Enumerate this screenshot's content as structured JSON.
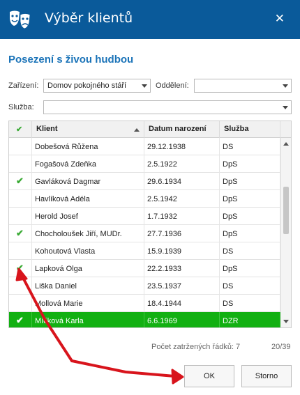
{
  "window": {
    "title": "Výběr klientů",
    "close_glyph": "✕",
    "icon": "theater-masks-icon"
  },
  "heading": "Posezení s živou hudbou",
  "filters": {
    "zarizeni_label": "Zařízení:",
    "zarizeni_value": "Domov pokojného stáří",
    "oddeleni_label": "Oddělení:",
    "oddeleni_value": "",
    "sluzba_label": "Služba:",
    "sluzba_value": ""
  },
  "grid": {
    "check_header_glyph": "✔",
    "columns": [
      "Klient",
      "Datum narození",
      "Služba"
    ],
    "rows": [
      {
        "checked": false,
        "client": "Dobešová Růžena",
        "birth": "29.12.1938",
        "service": "DS",
        "selected": false
      },
      {
        "checked": false,
        "client": "Fogašová Zdeňka",
        "birth": "2.5.1922",
        "service": "DpS",
        "selected": false
      },
      {
        "checked": true,
        "client": "Gavláková Dagmar",
        "birth": "29.6.1934",
        "service": "DpS",
        "selected": false
      },
      {
        "checked": false,
        "client": "Havlíková Adéla",
        "birth": "2.5.1942",
        "service": "DpS",
        "selected": false
      },
      {
        "checked": false,
        "client": "Herold Josef",
        "birth": "1.7.1932",
        "service": "DpS",
        "selected": false
      },
      {
        "checked": true,
        "client": "Chocholoušek Jiří, MUDr.",
        "birth": "27.7.1936",
        "service": "DpS",
        "selected": false
      },
      {
        "checked": false,
        "client": "Kohoutová Vlasta",
        "birth": "15.9.1939",
        "service": "DS",
        "selected": false
      },
      {
        "checked": true,
        "client": "Lapková Olga",
        "birth": "22.2.1933",
        "service": "DpS",
        "selected": false
      },
      {
        "checked": false,
        "client": "Liška Daniel",
        "birth": "23.5.1937",
        "service": "DS",
        "selected": false
      },
      {
        "checked": false,
        "client": "Mollová Marie",
        "birth": "18.4.1944",
        "service": "DS",
        "selected": false
      },
      {
        "checked": true,
        "client": "Míčková Karla",
        "birth": "6.6.1969",
        "service": "DZR",
        "selected": true
      }
    ]
  },
  "status": {
    "checked_rows_label": "Počet zatržených řádků: 7",
    "count": "20/39"
  },
  "buttons": {
    "ok": "OK",
    "cancel": "Storno"
  },
  "colors": {
    "titlebar": "#0a5a9a",
    "heading": "#1a73b8",
    "selection": "#12b012",
    "check": "#3aaa35",
    "annotation_arrow": "#d8141c"
  }
}
